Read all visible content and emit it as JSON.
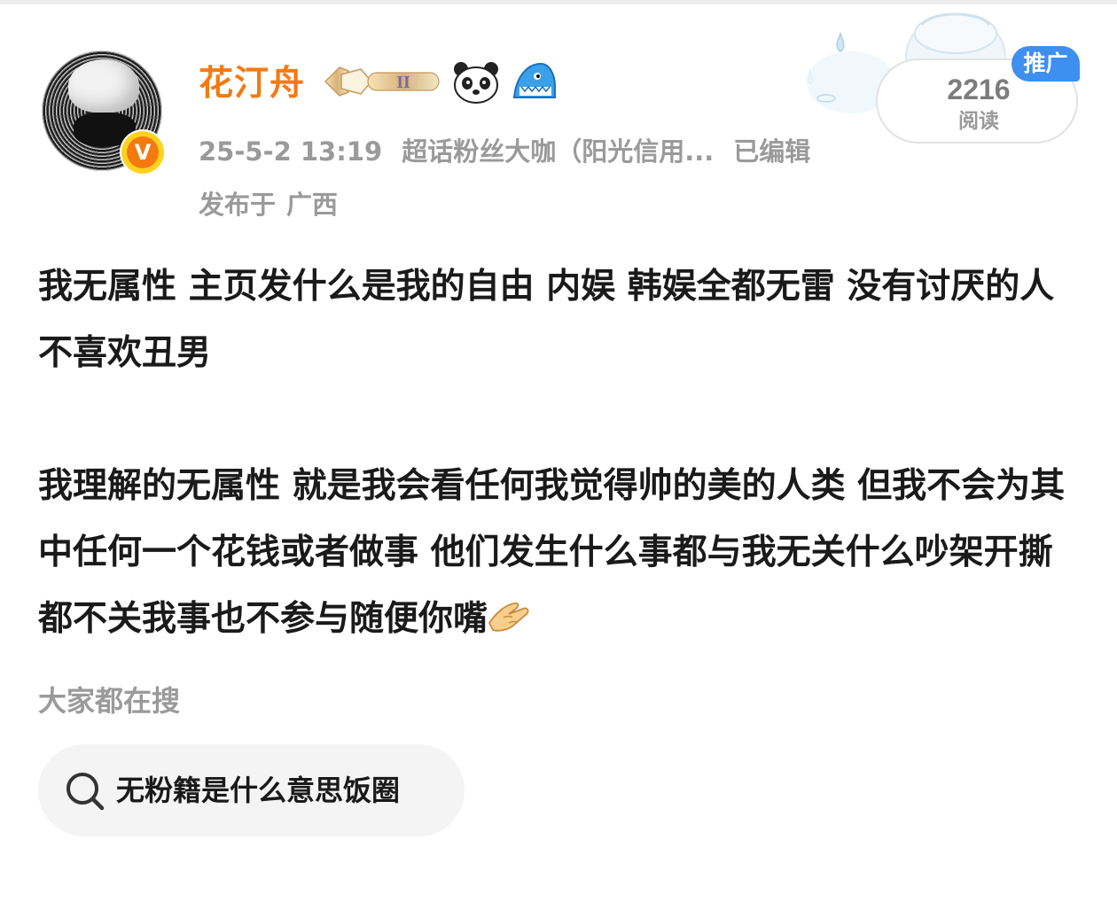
{
  "post": {
    "author": {
      "name": "花汀舟",
      "verified_badge": "V",
      "badges": [
        "fan-medal-level-II-icon",
        "panda-icon",
        "shark-icon"
      ]
    },
    "meta": {
      "timestamp": "25-5-2 13:19",
      "source": "超话粉丝大咖（阳光信用...",
      "edited": "已编辑"
    },
    "location": {
      "prefix": "发布于",
      "place": "广西"
    },
    "read": {
      "count": "2216",
      "label": "阅读",
      "promo": "推广"
    },
    "paragraphs": [
      "我无属性 主页发什么是我的自由 内娱 韩娱全都无雷 没有讨厌的人 不喜欢丑男",
      "我理解的无属性 就是我会看任何我觉得帅的美的人类 但我不会为其中任何一个花钱或者做事 他们发生什么事都与我无关什么吵架开撕都不关我事也不参与随便你嘴"
    ]
  },
  "trending": {
    "heading": "大家都在搜",
    "query": "无粉籍是什么意思饭圈"
  },
  "colors": {
    "username": "#f47a10",
    "meta": "#9a9a9a",
    "body_text": "#1a1a1a",
    "promo": "#3d8ff0",
    "chip_bg": "#f4f4f4"
  }
}
